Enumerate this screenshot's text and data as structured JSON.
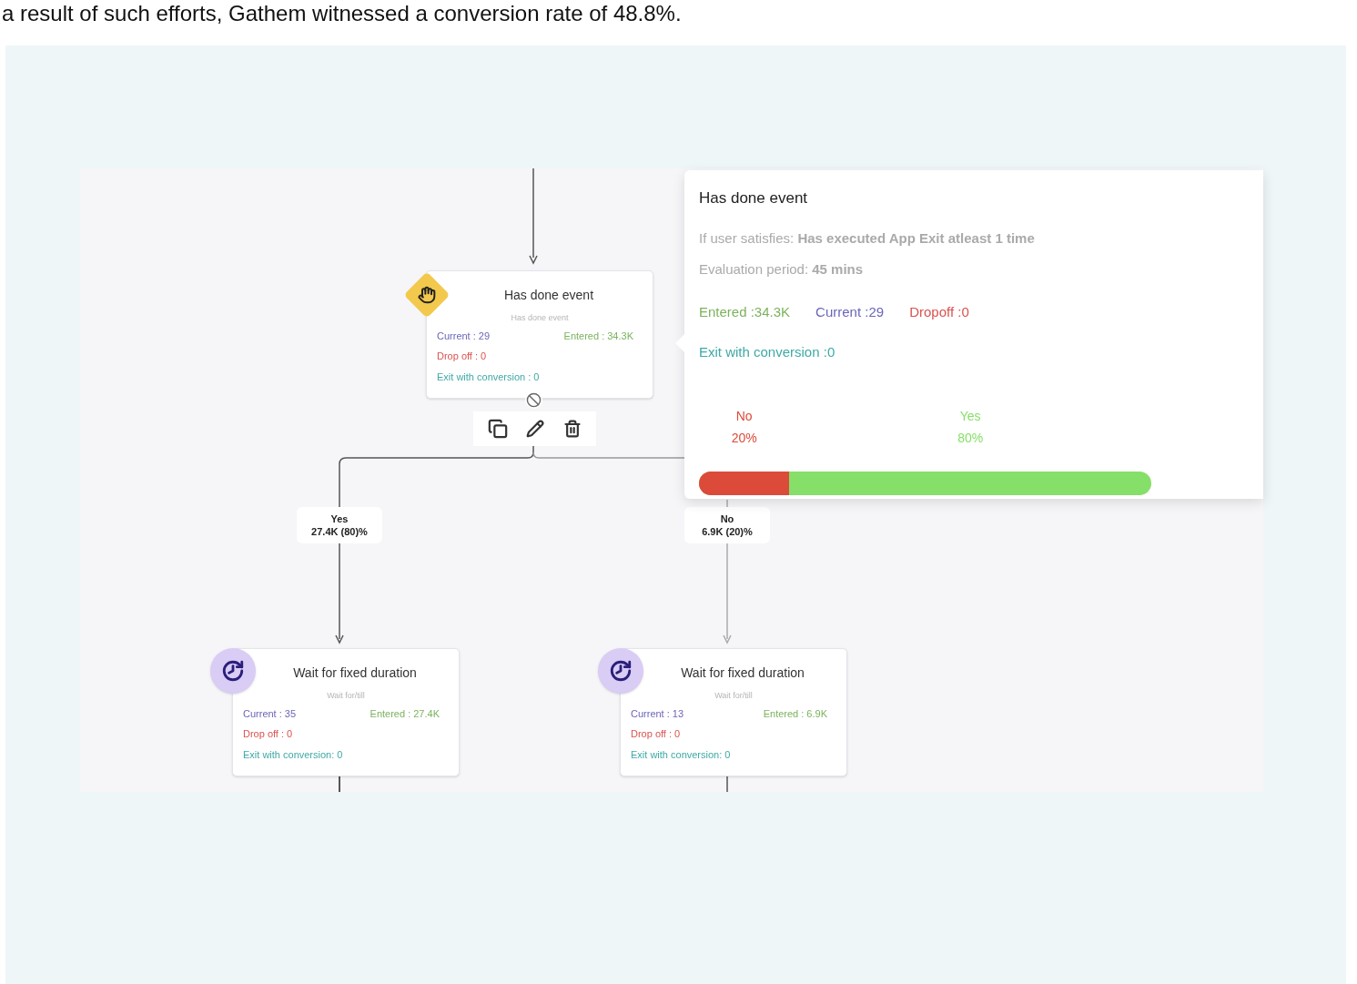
{
  "intro_text": "a result of such efforts, Gathem witnessed a conversion rate of 48.8%.",
  "canvas": {
    "nodes": [
      {
        "kind": "event",
        "title": "Has done event",
        "subtitle": "Has done event",
        "current": "Current : 29",
        "entered": "Entered : 34.3K",
        "drop_off": "Drop off : 0",
        "exit_with_conversion": "Exit with conversion : 0"
      },
      {
        "kind": "wait",
        "title": "Wait for fixed duration",
        "subtitle": "Wait for/till",
        "current": "Current : 35",
        "entered": "Entered : 27.4K",
        "drop_off": "Drop off : 0",
        "exit_with_conversion": "Exit with conversion: 0"
      },
      {
        "kind": "wait",
        "title": "Wait for fixed duration",
        "subtitle": "Wait for/till",
        "current": "Current : 13",
        "entered": "Entered : 6.9K",
        "drop_off": "Drop off : 0",
        "exit_with_conversion": "Exit with conversion: 0"
      }
    ],
    "branches": [
      {
        "label": "Yes",
        "count": "27.4K (80)%"
      },
      {
        "label": "No",
        "count": "6.9K (20)%"
      }
    ],
    "popover": {
      "title": "Has done event",
      "condition": "If user satisfies: **Has executed App Exit atleast 1 time**",
      "evaluation": "Evaluation period: **45 mins**",
      "entered": "Entered :34.3K",
      "current": "Current :29",
      "dropoff": "Dropoff :0",
      "exit_with_conversion": "Exit with conversion :0",
      "split_bar": {
        "level": 0.2
      },
      "split": [
        {
          "label": "No",
          "percent": "20%",
          "color": "#dc4a3a"
        },
        {
          "label": "Yes",
          "percent": "80%",
          "color": "#86df68"
        }
      ]
    }
  }
}
